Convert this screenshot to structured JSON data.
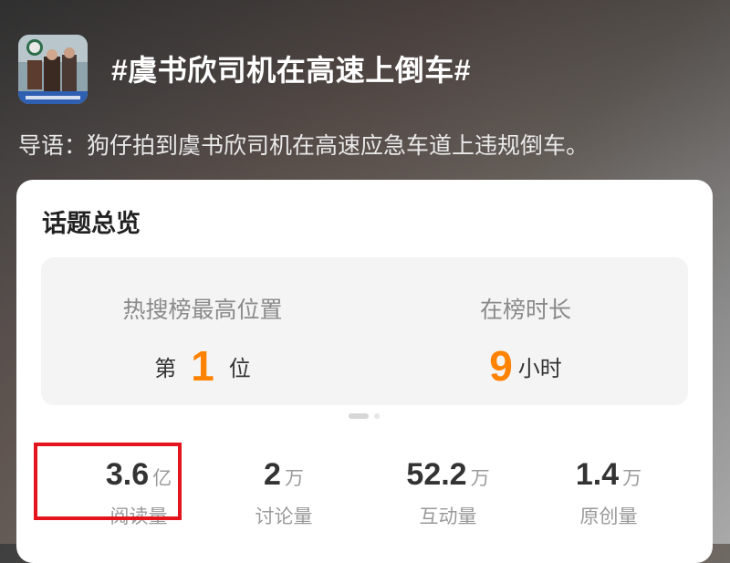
{
  "topic": {
    "title": "#虞书欣司机在高速上倒车#",
    "intro": "导语：狗仔拍到虞书欣司机在高速应急车道上违规倒车。",
    "thumbnail_icon": "video-thumbnail"
  },
  "overview": {
    "title": "话题总览",
    "left": {
      "label": "热搜榜最高位置",
      "prefix": "第",
      "value": "1",
      "suffix": "位"
    },
    "right": {
      "label": "在榜时长",
      "value": "9",
      "suffix": "小时"
    }
  },
  "metrics": [
    {
      "value": "3.6",
      "unit": "亿",
      "label": "阅读量"
    },
    {
      "value": "2",
      "unit": "万",
      "label": "讨论量"
    },
    {
      "value": "52.2",
      "unit": "万",
      "label": "互动量"
    },
    {
      "value": "1.4",
      "unit": "万",
      "label": "原创量"
    }
  ],
  "colors": {
    "accent": "#ff8200",
    "highlight": "#e3141b"
  }
}
